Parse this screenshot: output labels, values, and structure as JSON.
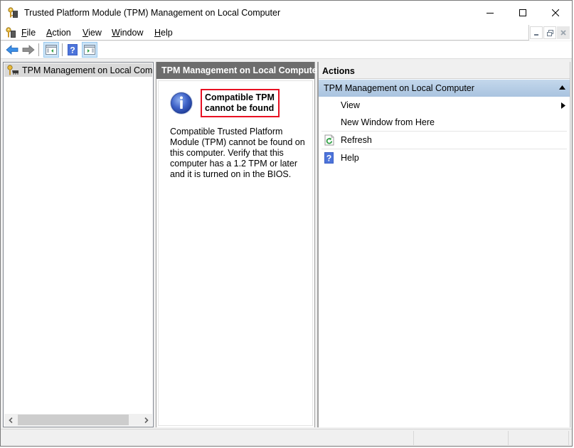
{
  "window": {
    "title": "Trusted Platform Module (TPM) Management on Local Computer",
    "controls": {
      "minimize": "minimize",
      "maximize": "maximize",
      "close": "close"
    }
  },
  "menubar": {
    "items": [
      {
        "label": "File",
        "accel": "F",
        "rest": "ile"
      },
      {
        "label": "Action",
        "accel": "A",
        "rest": "ction"
      },
      {
        "label": "View",
        "accel": "V",
        "rest": "iew"
      },
      {
        "label": "Window",
        "accel": "W",
        "rest": "indow"
      },
      {
        "label": "Help",
        "accel": "H",
        "rest": "elp"
      }
    ]
  },
  "toolbar": {
    "buttons": [
      "back",
      "forward",
      "show-hide-console-tree",
      "help",
      "show-hide-action-pane"
    ]
  },
  "tree": {
    "items": [
      {
        "label": "TPM Management on Local Comp",
        "selected": true
      }
    ]
  },
  "center": {
    "header": "TPM Management on Local Computer",
    "alert_title_line1": "Compatible TPM",
    "alert_title_line2": "cannot be found",
    "description": "Compatible Trusted Platform Module (TPM) cannot be found on this computer. Verify that this computer has a 1.2 TPM or later and it is turned on in the BIOS."
  },
  "actions": {
    "header": "Actions",
    "group_label": "TPM Management on Local Computer",
    "items": [
      {
        "label": "View",
        "icon": "",
        "submenu": true
      },
      {
        "label": "New Window from Here",
        "icon": ""
      },
      {
        "label": "Refresh",
        "icon": "refresh-icon"
      },
      {
        "label": "Help",
        "icon": "help-icon"
      }
    ]
  },
  "colors": {
    "alert_border": "#e81123",
    "center_header_bg": "#6d6d6d",
    "actions_group_bg": "#b8cfe7",
    "selection_bg": "#d9d9d9"
  }
}
